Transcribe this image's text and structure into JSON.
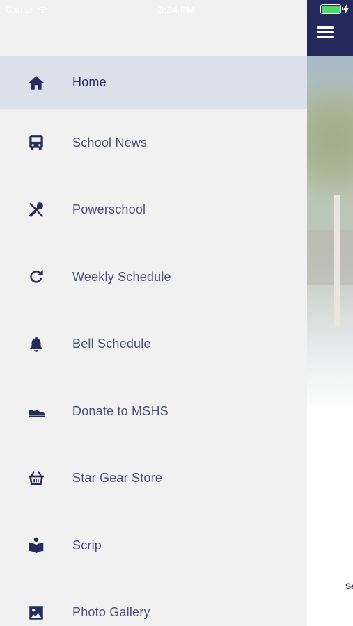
{
  "status_bar": {
    "carrier": "Carrier",
    "time": "3:34 PM",
    "battery_percent": 100,
    "wifi_icon": "wifi-icon",
    "charging_icon": "bolt-icon"
  },
  "drawer": {
    "items": [
      {
        "label": "Home",
        "icon": "home-icon",
        "active": true
      },
      {
        "label": "School News",
        "icon": "bus-icon",
        "active": false
      },
      {
        "label": "Powerschool",
        "icon": "utensils-icon",
        "active": false
      },
      {
        "label": "Weekly Schedule",
        "icon": "refresh-icon",
        "active": false
      },
      {
        "label": "Bell Schedule",
        "icon": "bell-icon",
        "active": false
      },
      {
        "label": "Donate to MSHS",
        "icon": "shoe-icon",
        "active": false
      },
      {
        "label": "Star Gear Store",
        "icon": "basket-icon",
        "active": false
      },
      {
        "label": "Scrip",
        "icon": "book-reader-icon",
        "active": false
      },
      {
        "label": "Photo Gallery",
        "icon": "image-icon",
        "active": false
      }
    ]
  },
  "main": {
    "menu_icon": "hamburger-icon",
    "peek_text": "Se"
  },
  "colors": {
    "brand_navy": "#23295a",
    "active_item_bg": "#dbe1eb",
    "drawer_bg": "#f1f1f2"
  }
}
